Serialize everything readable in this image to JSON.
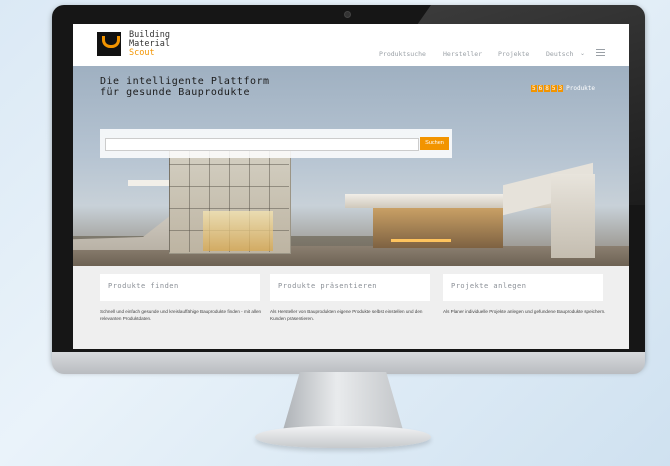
{
  "brand": {
    "line1": "Building",
    "line2": "Material",
    "line3": "Scout",
    "accent_color": "#f29400",
    "logo_icon": "u-cup-icon"
  },
  "nav": {
    "items": [
      "Produktsuche",
      "Hersteller",
      "Projekte",
      "Deutsch"
    ],
    "menu_icon": "hamburger-icon"
  },
  "hero": {
    "title_line1": "Die intelligente Plattform",
    "title_line2": "für gesunde Bauprodukte",
    "counter_digits": [
      "5",
      "6",
      "8",
      "5",
      "3"
    ],
    "counter_label": "Produkte",
    "search_placeholder": "",
    "search_button": "Suchen"
  },
  "features": [
    {
      "title": "Produkte finden",
      "text": "Schnell und einfach gesunde und kreislauffähige Bauprodukte finden - mit allen relevanten Produktdaten."
    },
    {
      "title": "Produkte präsentieren",
      "text": "Als Hersteller von Bauprodukten eigene Produkte selbst einstellen und den Kunden präsentieren."
    },
    {
      "title": "Projekte anlegen",
      "text": "Als Planer individuelle Projekte anlegen und gefundene Bauprodukte speichern."
    }
  ]
}
